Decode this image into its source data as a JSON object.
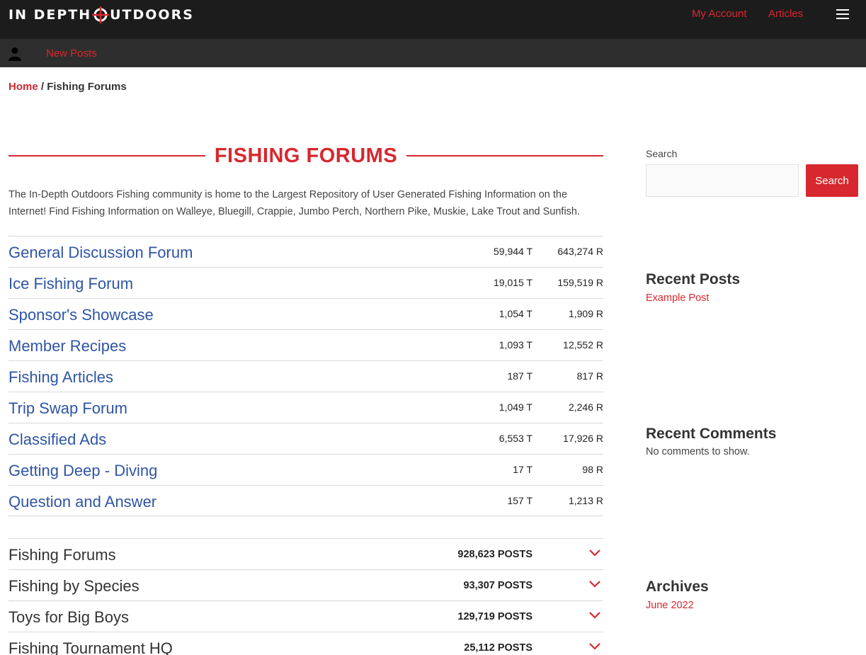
{
  "header": {
    "logo_left": "IN DEPTH",
    "logo_right": "UTDOORS",
    "nav": [
      "My Account",
      "Articles"
    ]
  },
  "subnav": {
    "new_posts": "New Posts"
  },
  "breadcrumb": {
    "home": "Home",
    "separator": " / ",
    "current": "Fishing Forums"
  },
  "page": {
    "title": "FISHING FORUMS",
    "intro": "The In-Depth Outdoors Fishing community is home to the Largest Repository of User Generated Fishing Information on the Internet! Find Fishing Information on Walleye, Bluegill, Crappie, Jumbo Perch, Northern Pike, Muskie, Lake Trout and Sunfish."
  },
  "forums": [
    {
      "name": "General Discussion Forum",
      "topics": "59,944 T",
      "replies": "643,274 R"
    },
    {
      "name": "Ice Fishing Forum",
      "topics": "19,015 T",
      "replies": "159,519 R"
    },
    {
      "name": "Sponsor's Showcase",
      "topics": "1,054 T",
      "replies": "1,909 R"
    },
    {
      "name": "Member Recipes",
      "topics": "1,093 T",
      "replies": "12,552 R"
    },
    {
      "name": "Fishing Articles",
      "topics": "187 T",
      "replies": "817 R"
    },
    {
      "name": "Trip Swap Forum",
      "topics": "1,049 T",
      "replies": "2,246 R"
    },
    {
      "name": "Classified Ads",
      "topics": "6,553 T",
      "replies": "17,926 R"
    },
    {
      "name": "Getting Deep - Diving",
      "topics": "17 T",
      "replies": "98 R"
    },
    {
      "name": "Question and Answer",
      "topics": "157 T",
      "replies": "1,213 R"
    }
  ],
  "categories": [
    {
      "name": "Fishing Forums",
      "posts": "928,623 POSTS"
    },
    {
      "name": "Fishing by Species",
      "posts": "93,307 POSTS"
    },
    {
      "name": "Toys for Big Boys",
      "posts": "129,719 POSTS"
    },
    {
      "name": "Fishing Tournament HQ",
      "posts": "25,112 POSTS"
    }
  ],
  "sidebar": {
    "search_label": "Search",
    "search_value": "",
    "search_button": "Search",
    "recent_posts_title": "Recent Posts",
    "recent_posts": [
      "Example Post"
    ],
    "recent_comments_title": "Recent Comments",
    "recent_comments_empty": "No comments to show.",
    "archives_title": "Archives",
    "archives": [
      "June 2022"
    ]
  },
  "colors": {
    "brand_red": "#d7282f",
    "link_blue": "#2f55a4",
    "topbar": "#1c1c1c",
    "subbar": "#2e2e2e"
  }
}
